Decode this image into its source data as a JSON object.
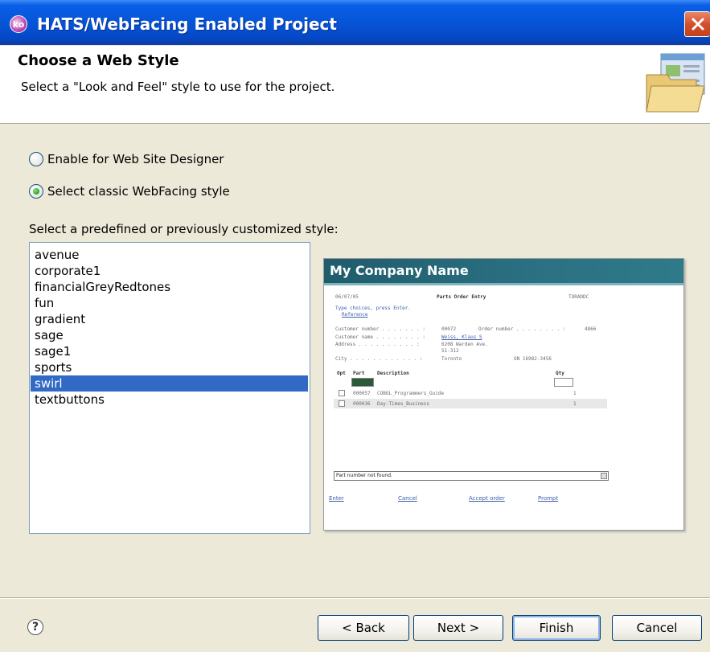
{
  "window": {
    "title": "HATS/WebFacing Enabled Project",
    "app_icon_text": "ko"
  },
  "header": {
    "title": "Choose a Web Style",
    "description": "Select a \"Look and Feel\" style to use for the project."
  },
  "options": {
    "web_site_designer": {
      "label": "Enable for Web Site Designer",
      "checked": false
    },
    "classic_style": {
      "label": "Select classic WebFacing style",
      "checked": true
    }
  },
  "style_list": {
    "caption": "Select a predefined or previously customized style:",
    "items": [
      "avenue",
      "corporate1",
      "financialGreyRedtones",
      "fun",
      "gradient",
      "sage",
      "sage1",
      "sports",
      "swirl",
      "textbuttons"
    ],
    "selected": "swirl"
  },
  "preview": {
    "company_name": "My Company Name",
    "date": "06/07/05",
    "screen_title": "Parts Order Entry",
    "program_id": "TORADDC",
    "instructions": "Type choices, press Enter.",
    "reference_link": "Reference",
    "customer_number_label": "Customer number . . . . . . . :",
    "customer_number_value": "00072",
    "order_number_label": "Order number . . . . . . . . :",
    "order_number_value": "4866",
    "customer_name_label": "Customer name . . . . . . . . :",
    "customer_name_value": "Weiss, Klaus S",
    "address_label": "Address . . . . . . . . . . :",
    "address_line1": "6208 Warden Ave.",
    "address_line2": "S1-312",
    "city_label": "City . . . . . . . . . . . . :",
    "city_value": "Toronto",
    "province_postal": "ON 16982-3456",
    "col_opt": "Opt",
    "col_part": "Part",
    "col_description": "Description",
    "col_qty": "Qty",
    "rows": [
      {
        "part": "000057",
        "description": "COBOL_Programmers_Guide",
        "qty": "1"
      },
      {
        "part": "000036",
        "description": "Day-Times_Business",
        "qty": "1"
      }
    ],
    "message": "Part number not found.",
    "links": [
      "Enter",
      "Cancel",
      "Accept order",
      "Prompt"
    ]
  },
  "buttons": {
    "back": "< Back",
    "next": "Next >",
    "finish": "Finish",
    "cancel": "Cancel"
  },
  "help_icon_glyph": "?",
  "colors": {
    "title_bar": "#0655d8",
    "selection": "#316ac5",
    "preview_banner": "#1f5c6c"
  }
}
